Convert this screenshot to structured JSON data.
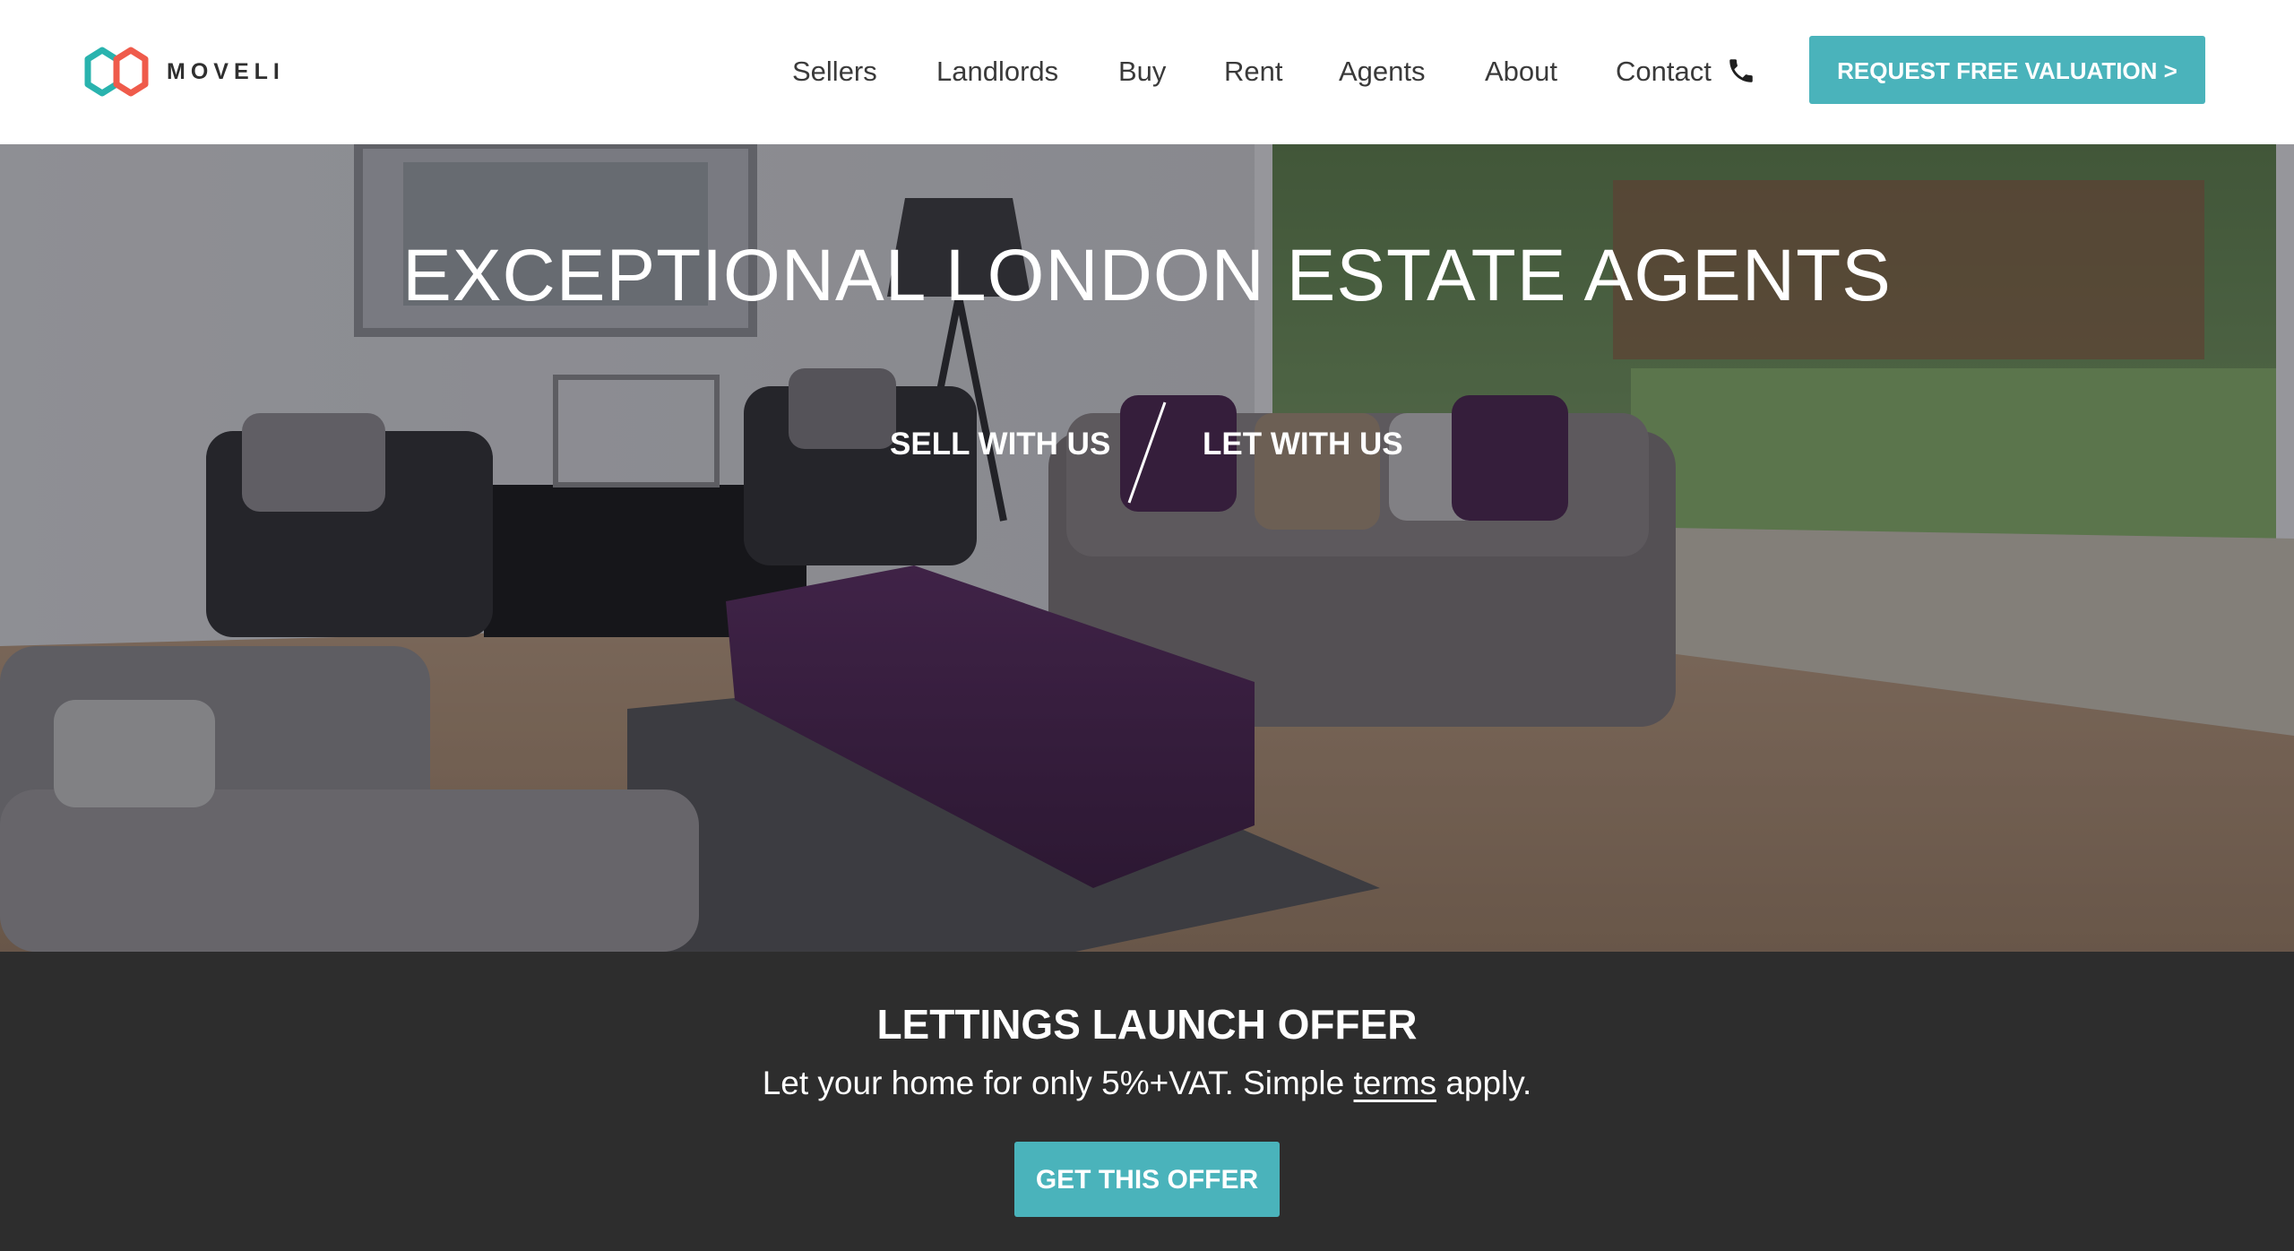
{
  "brand": {
    "name": "MOVELI",
    "colors": {
      "accent": "#4ab3bb",
      "logo_teal": "#29b3ae",
      "logo_red": "#ef5b4b",
      "dark_band": "#2d2d2d"
    }
  },
  "nav": {
    "items": [
      "Sellers",
      "Landlords",
      "Buy",
      "Rent",
      "Agents",
      "About",
      "Contact"
    ],
    "contact_icon": "phone-icon",
    "cta_label": "REQUEST FREE VALUATION >"
  },
  "hero": {
    "title": "EXCEPTIONAL LONDON ESTATE AGENTS",
    "sell_label": "SELL WITH US",
    "let_label": "LET WITH US"
  },
  "offer": {
    "title": "LETTINGS LAUNCH OFFER",
    "text_before": "Let your home for only 5%+VAT. Simple ",
    "link": "terms",
    "text_after": " apply.",
    "cta_label": "GET THIS OFFER"
  }
}
